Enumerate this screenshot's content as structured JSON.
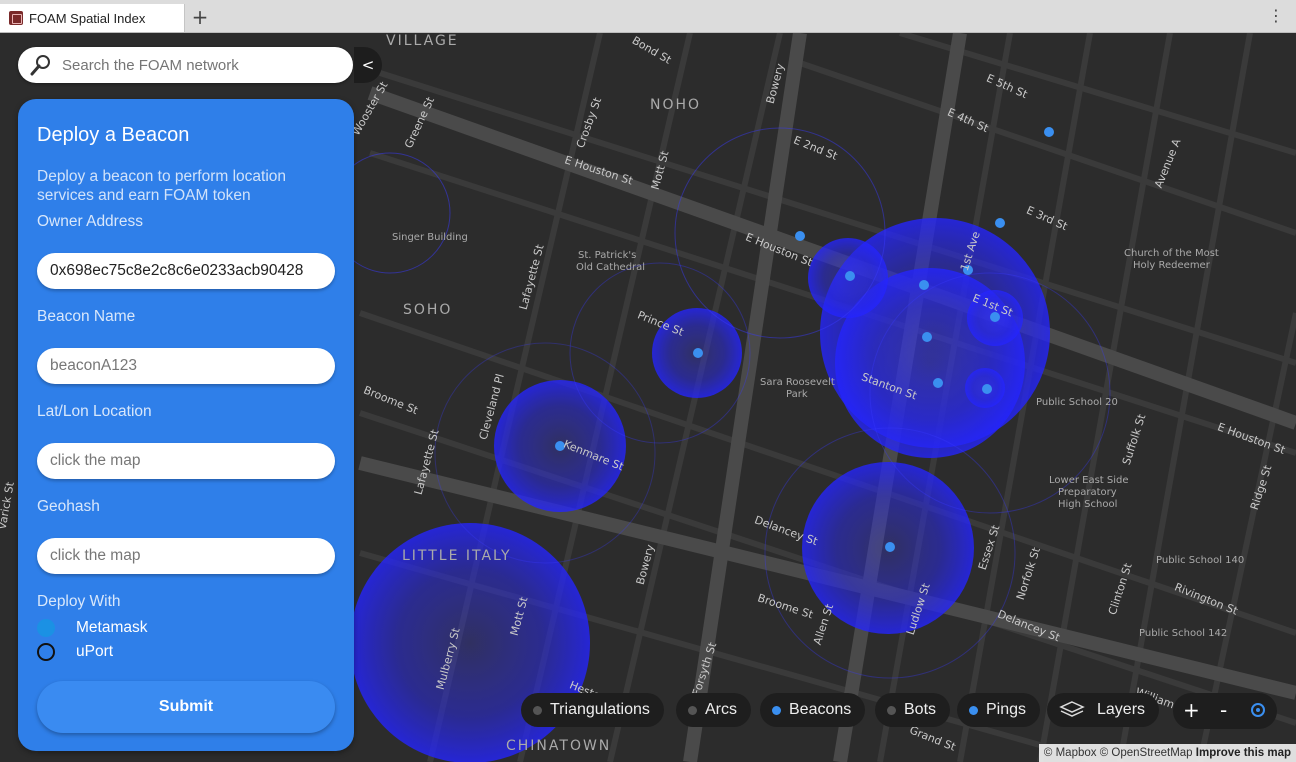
{
  "browser": {
    "tab_title": "FOAM Spatial Index",
    "newtab_glyph": "+",
    "menu_glyph": "⋮"
  },
  "search": {
    "placeholder": "Search the FOAM network",
    "collapse_glyph": "<"
  },
  "panel": {
    "title": "Deploy a Beacon",
    "description": "Deploy a beacon to perform location services and earn FOAM token",
    "owner_label": "Owner Address",
    "owner_value": "0x698ec75c8e2c8c6e0233acb90428",
    "name_label": "Beacon Name",
    "name_placeholder": "beaconA123",
    "latlon_label": "Lat/Lon Location",
    "latlon_placeholder": "click the map",
    "geohash_label": "Geohash",
    "geohash_placeholder": "click the map",
    "deploy_label": "Deploy With",
    "options": [
      {
        "label": "Metamask",
        "selected": true
      },
      {
        "label": "uPort",
        "selected": false
      }
    ],
    "submit_label": "Submit"
  },
  "layers": [
    {
      "label": "Triangulations",
      "active": false
    },
    {
      "label": "Arcs",
      "active": false
    },
    {
      "label": "Beacons",
      "active": true
    },
    {
      "label": "Bots",
      "active": false
    },
    {
      "label": "Pings",
      "active": true
    }
  ],
  "layers_button": "Layers",
  "zoom": {
    "in": "+",
    "out": "-"
  },
  "attribution": {
    "mapbox": "© Mapbox",
    "osm": "© OpenStreetMap",
    "improve": "Improve this map"
  },
  "map_labels": {
    "village": "VILLAGE",
    "noho": "NOHO",
    "soho": "SOHO",
    "little_italy": "LITTLE ITALY",
    "chinatown": "CHINATOWN",
    "singer": "Singer Building",
    "st_patricks_1": "St. Patrick's",
    "st_patricks_2": "Old Cathedral",
    "sara_1": "Sara Roosevelt",
    "sara_2": "Park",
    "church_1": "Church of the Most",
    "church_2": "Holy Redeemer",
    "ps20": "Public School 20",
    "les_1": "Lower East Side",
    "les_2": "Preparatory",
    "les_3": "High School",
    "ps140": "Public School 140",
    "ps142": "Public School 142"
  },
  "streets": {
    "e_houston_1": "E Houston St",
    "e_houston_2": "E Houston St",
    "e_houston_3": "E Houston St",
    "bowery_1": "Bowery",
    "bowery_2": "Bowery",
    "lafayette_1": "Lafayette St",
    "lafayette_2": "Lafayette St",
    "kenmare": "Kenmare St",
    "prince": "Prince St",
    "broome_1": "Broome St",
    "broome_2": "Broome St",
    "delancey_1": "Delancey St",
    "delancey_2": "Delancey St",
    "stanton": "Stanton St",
    "first_ave": "1st Ave",
    "e_first": "E 1st St",
    "e_second": "E 2nd St",
    "e_third": "E 3rd St",
    "e_fourth": "E 4th St",
    "e_fifth": "E 5th St",
    "avenue_a": "Avenue A",
    "essex": "Essex St",
    "norfolk": "Norfolk St",
    "suffolk": "Suffolk St",
    "clinton": "Clinton St",
    "ridge": "Ridge St",
    "rivington": "Rivington St",
    "ludlow": "Ludlow St",
    "allen": "Allen St",
    "forsyth": "Forsyth St",
    "mott_1": "Mott St",
    "mott_2": "Mott St",
    "mulberry": "Mulberry St",
    "cleveland": "Cleveland Pl",
    "crosby": "Crosby St",
    "greene": "Greene St",
    "wooster": "Wooster St",
    "bond": "Bond St",
    "grand": "Grand St",
    "hester": "Hester St",
    "william": "William",
    "varick": "Varick St"
  }
}
